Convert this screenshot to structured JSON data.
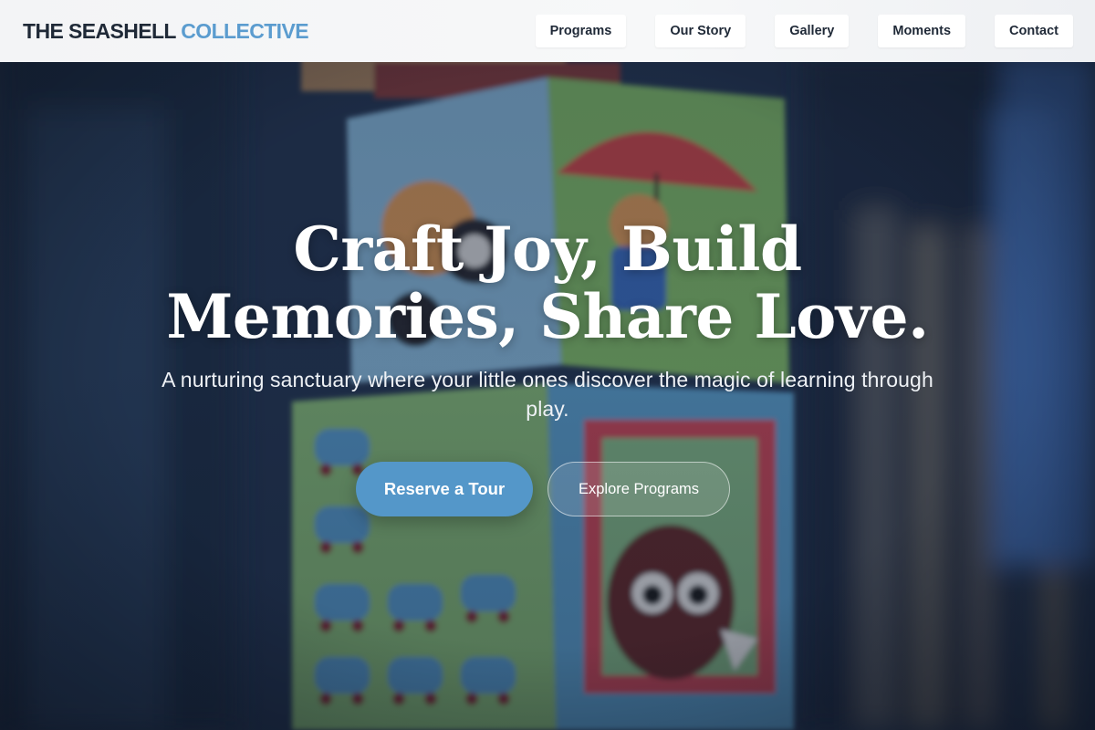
{
  "header": {
    "brand_part1": "THE SEASHELL",
    "brand_part2": "COLLECTIVE",
    "nav": [
      {
        "label": "Programs"
      },
      {
        "label": "Our Story"
      },
      {
        "label": "Gallery"
      },
      {
        "label": "Moments"
      },
      {
        "label": "Contact"
      }
    ]
  },
  "hero": {
    "headline_line1": "Craft Joy, Build",
    "headline_line2": "Memories, Share Love.",
    "subtitle": "A nurturing sanctuary where your little ones discover the magic of learning through play.",
    "primary_cta": "Reserve a Tour",
    "secondary_cta": "Explore Programs"
  },
  "colors": {
    "accent": "#5497c9",
    "brand_accent": "#5b9ccf",
    "brand_dark": "#1f2937"
  }
}
